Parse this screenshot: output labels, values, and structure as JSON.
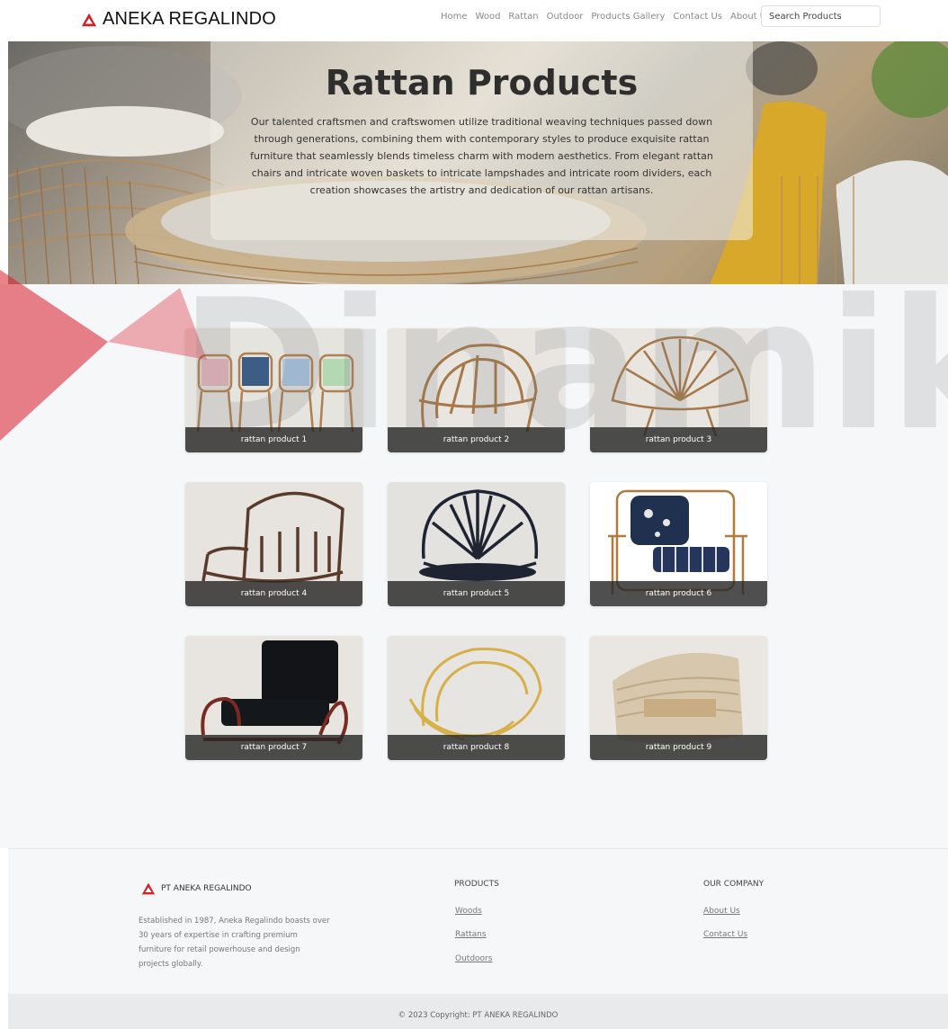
{
  "header": {
    "brand_name": "ANEKA REGALINDO",
    "logo_icon": "red-triangle-logo",
    "accent_color": "#d0202a",
    "nav": [
      "Home",
      "Wood",
      "Rattan",
      "Outdoor",
      "Products Gallery",
      "Contact Us",
      "About Us"
    ],
    "search_placeholder": "Search Products"
  },
  "hero": {
    "title": "Rattan Products",
    "description": "Our talented craftsmen and craftswomen utilize traditional weaving techniques passed down through generations, combining them with contemporary styles to produce exquisite rattan furniture that seamlessly blends timeless charm with modern aesthetics. From elegant rattan chairs and intricate woven baskets to intricate lampshades and intricate room dividers, each creation showcases the artistry and dedication of our rattan artisans."
  },
  "products": [
    {
      "label": "rattan product 1"
    },
    {
      "label": "rattan product 2"
    },
    {
      "label": "rattan product 3"
    },
    {
      "label": "rattan product 4"
    },
    {
      "label": "rattan product 5"
    },
    {
      "label": "rattan product 6"
    },
    {
      "label": "rattan product 7"
    },
    {
      "label": "rattan product 8"
    },
    {
      "label": "rattan product 9"
    }
  ],
  "watermark_text": "Dinamika",
  "footer": {
    "brand": "PT ANEKA REGALINDO",
    "description": "Established in 1987, Aneka Regalindo boasts over 30 years of expertise in crafting premium furniture for retail powerhouse and design projects globally.",
    "products_title": "PRODUCTS",
    "products_links": [
      "Woods",
      "Rattans",
      "Outdoors"
    ],
    "company_title": "OUR COMPANY",
    "company_links": [
      "About Us",
      "Contact Us"
    ],
    "copyright": "© 2023 Copyright: PT ANEKA REGALINDO"
  }
}
